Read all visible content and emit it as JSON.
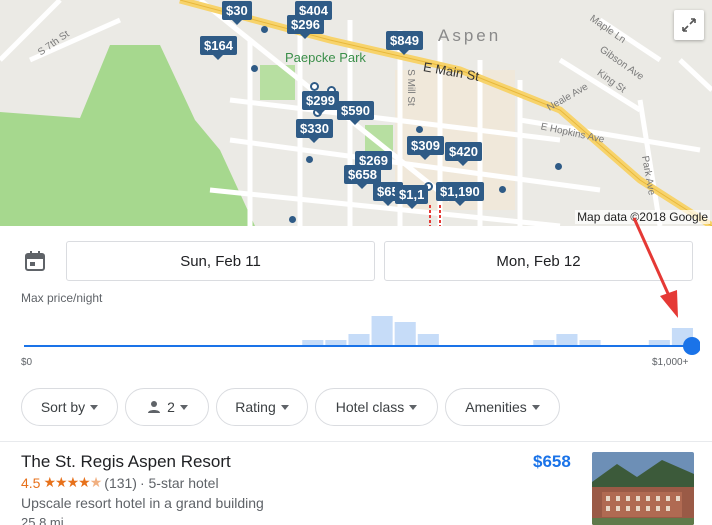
{
  "map": {
    "city_label": "Aspen",
    "park_label": "Paepcke Park",
    "street_labels": {
      "main": "E Main St",
      "hopkins": "E Hopkins Ave",
      "mill": "S Mill St",
      "fifth": "S 7th St",
      "maple": "Maple Ln",
      "gibson": "Gibson Ave",
      "king": "King St",
      "neale": "Neale Ave",
      "park": "Park Ave"
    },
    "price_pins": [
      "$30",
      "$404",
      "$296",
      "$164",
      "$849",
      "$299",
      "$590",
      "$330",
      "$309",
      "$420",
      "$269",
      "$658",
      "$65",
      "$1,1",
      "$1,190"
    ],
    "attribution": "Map data ©2018 Google"
  },
  "dates": {
    "checkin": "Sun, Feb 11",
    "checkout": "Mon, Feb 12"
  },
  "price_filter": {
    "label": "Max price/night",
    "min_label": "$0",
    "max_label": "$1,000+",
    "selected_fraction": 1.0,
    "histogram": [
      0,
      0,
      0,
      0,
      0,
      0,
      0,
      0,
      0,
      0,
      0,
      0,
      1,
      1,
      2,
      5,
      4,
      2,
      0,
      0,
      0,
      0,
      1,
      2,
      1,
      0,
      0,
      1,
      3
    ],
    "track_color": "#1a73e8",
    "bar_color": "#c6dcf8"
  },
  "filters": {
    "sort_by": "Sort by",
    "guests": "2",
    "rating": "Rating",
    "hotel_class": "Hotel class",
    "amenities": "Amenities"
  },
  "hotel": {
    "name": "The St. Regis Aspen Resort",
    "price": "$658",
    "rating": "4.5",
    "stars": 4.5,
    "reviews": "(131)",
    "class": "· 5-star hotel",
    "description": "Upscale resort hotel in a grand building",
    "distance": "25.8 mi"
  }
}
